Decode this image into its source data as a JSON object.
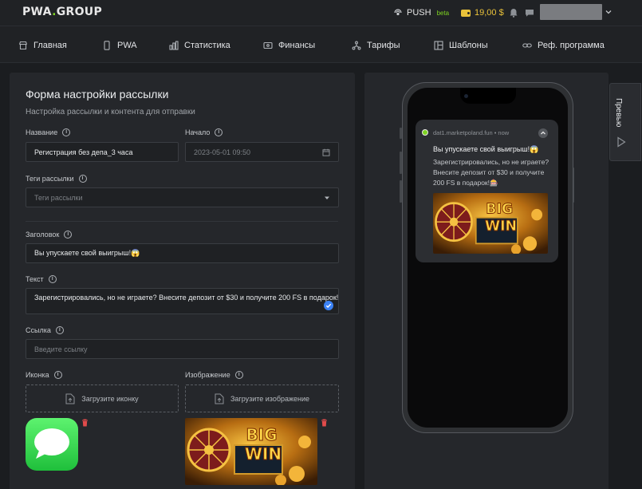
{
  "header": {
    "logo_part1": "PWA",
    "logo_part2": "GROUP",
    "push_label": "PUSH",
    "push_badge": "beta",
    "balance": "19,00 $",
    "accent_color": "#7ed321",
    "balance_color": "#e9c23a"
  },
  "nav": {
    "items": [
      {
        "label": "Главная",
        "icon": "store-icon"
      },
      {
        "label": "PWA",
        "icon": "phone-icon"
      },
      {
        "label": "Статистика",
        "icon": "bar-chart-icon"
      },
      {
        "label": "Финансы",
        "icon": "wallet-icon"
      },
      {
        "label": "Тарифы",
        "icon": "network-icon"
      },
      {
        "label": "Шаблоны",
        "icon": "template-icon"
      },
      {
        "label": "Реф. программа",
        "icon": "link-icon"
      }
    ]
  },
  "form": {
    "title": "Форма настройки рассылки",
    "subtitle": "Настройка рассылки и контента для отправки",
    "name_label": "Название",
    "name_value": "Регистрация без депа_3 часа",
    "start_label": "Начало",
    "start_value": "2023-05-01 09:50",
    "tags_label": "Теги рассылки",
    "tags_placeholder": "Теги рассылки",
    "heading_label": "Заголовок",
    "heading_value": "Вы упускаете свой выигрыш!😱",
    "text_label": "Текст",
    "text_value": "Зарегистрировались, но не играете? Внесите депозит от $30 и получите 200 FS в подарок!🎰",
    "link_label": "Ссылка",
    "link_placeholder": "Введите ссылку",
    "icon_label": "Иконка",
    "icon_upload": "Загрузите иконку",
    "image_label": "Изображение",
    "image_upload": "Загрузите изображение",
    "banner_line1": "BIG",
    "banner_line2": "WIN"
  },
  "preview": {
    "tab_label": "Превью",
    "source": "dat1.marketpoland.fun • now",
    "title": "Вы упускаете свой выигрыш!😱",
    "text": "Зарегистрировались, но не играете? Внесите депозит от $30 и получите 200 FS в подарок!🎰"
  }
}
